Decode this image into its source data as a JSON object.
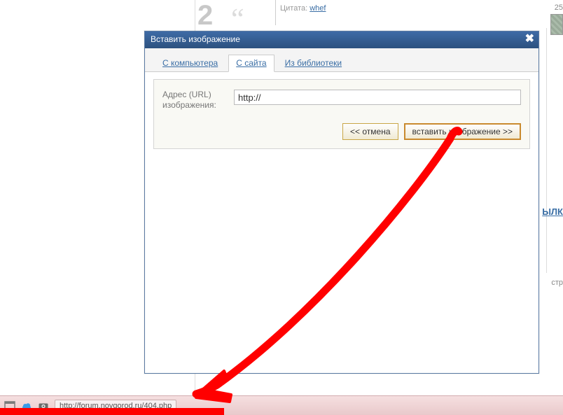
{
  "background": {
    "quote_label": "Цитата:",
    "quote_user": "whef",
    "big_char": "2",
    "side_date": "25",
    "side_link": "ЫЛК",
    "side_ctr": "стр"
  },
  "dialog": {
    "title": "Вставить изображение",
    "tabs": [
      {
        "label": "С компьютера",
        "active": false
      },
      {
        "label": "С сайта",
        "active": true
      },
      {
        "label": "Из библиотеки",
        "active": false
      }
    ],
    "url_label": "Адрес (URL) изображения:",
    "url_value": "http://",
    "cancel_label": "<< отмена",
    "insert_label": "вставить изображение >>"
  },
  "taskbar": {
    "url": "http://forum.novgorod.ru/404.php"
  },
  "colors": {
    "dialog_header": "#2d517f",
    "accent_link": "#3a6ea5",
    "annotation": "#ff0000",
    "taskbar_bg": "#e9c9cb"
  }
}
